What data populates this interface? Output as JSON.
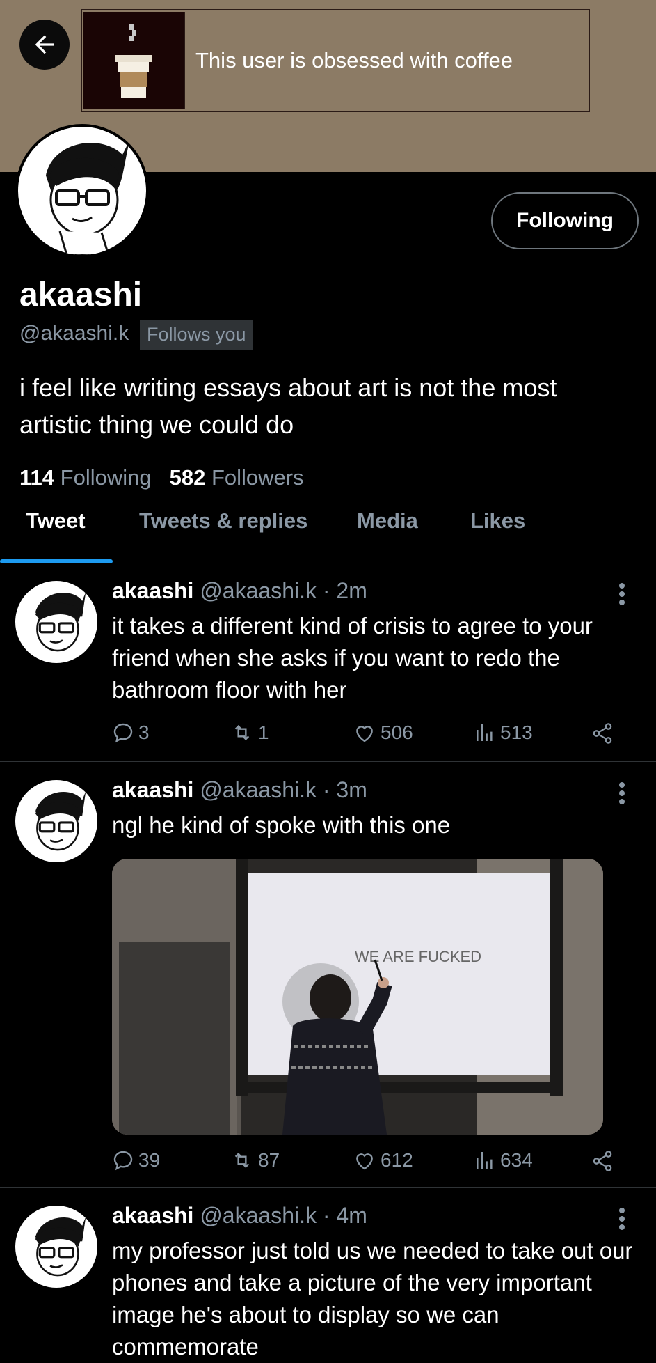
{
  "banner": {
    "userbox_text": "This user is obsessed with coffee",
    "userbox_icon": "coffee-cup-icon",
    "color": "#8c7b65"
  },
  "profile": {
    "follow_button": "Following",
    "name": "akaashi",
    "handle": "@akaashi.k",
    "follows_you": "Follows you",
    "bio": "i feel like writing essays about art is not the most artistic thing we could do",
    "following_count": "114",
    "following_label": "Following",
    "followers_count": "582",
    "followers_label": "Followers"
  },
  "tabs": [
    {
      "label": "Tweet",
      "active": true
    },
    {
      "label": "Tweets & replies",
      "active": false
    },
    {
      "label": "Media",
      "active": false
    },
    {
      "label": "Likes",
      "active": false
    }
  ],
  "tweets": [
    {
      "name": "akaashi",
      "meta": "@akaashi.k · 2m",
      "text": "it takes a different kind of crisis to agree to your friend when she asks if you want to redo the bathroom floor with her",
      "replies": "3",
      "retweets": "1",
      "likes": "506",
      "views": "513"
    },
    {
      "name": "akaashi",
      "meta": "@akaashi.k · 3m",
      "text": "ngl he kind of spoke with this one",
      "image_caption": "WE ARE FUCKED",
      "replies": "39",
      "retweets": "87",
      "likes": "612",
      "views": "634"
    },
    {
      "name": "akaashi",
      "meta": "@akaashi.k · 4m",
      "text": "my professor just told us we needed to take out our phones and take a picture of the very important image he's about to display so we can commemorate"
    }
  ],
  "colors": {
    "accent": "#1d9bf0",
    "muted": "#8b98a5",
    "divider": "#2f3336"
  }
}
